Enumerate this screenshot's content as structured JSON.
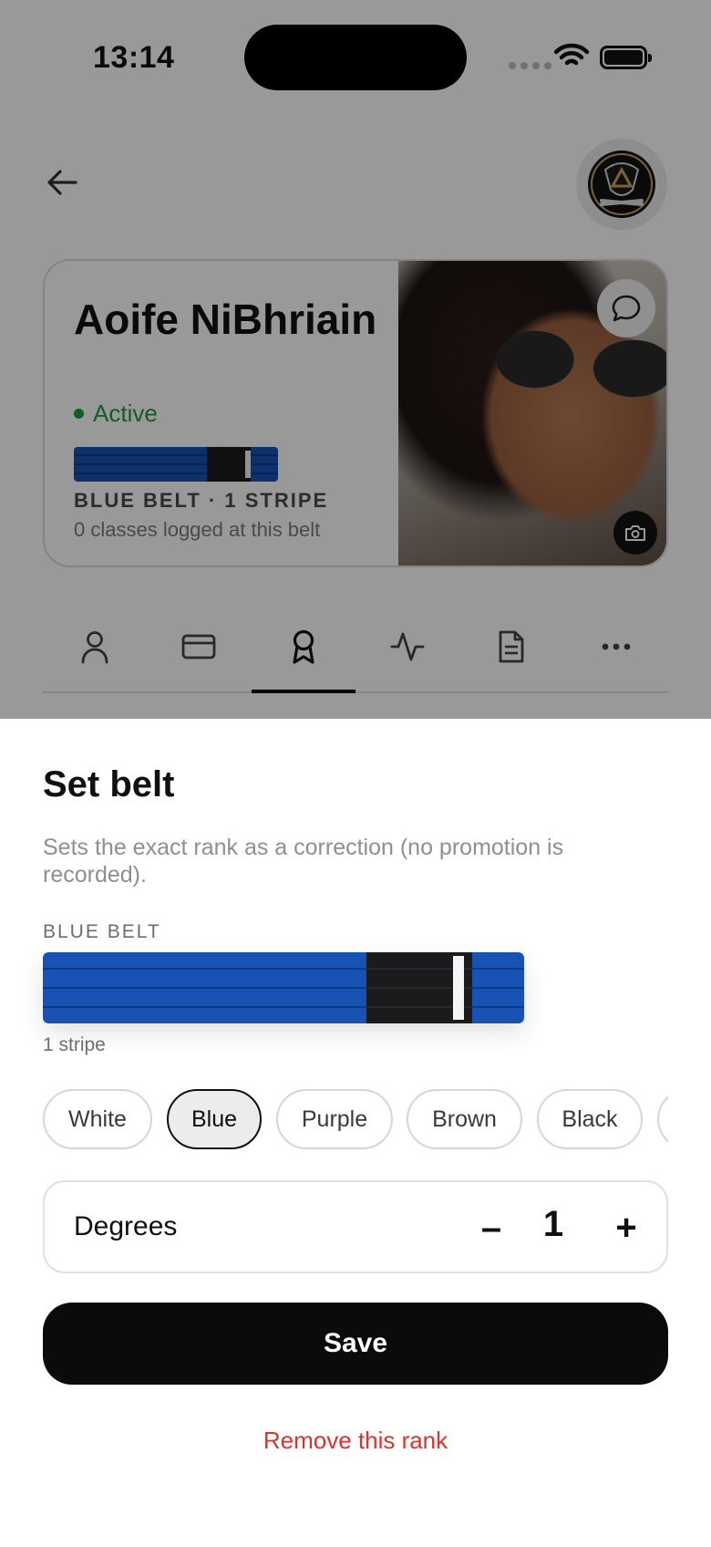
{
  "status_bar": {
    "time": "13:14"
  },
  "profile": {
    "name": "Aoife NiBhriain",
    "status": "Active",
    "rank": "BLUE BELT · 1 STRIPE",
    "classes": "0 classes logged at this belt"
  },
  "tabs": [
    "person-icon",
    "card-icon",
    "award-icon",
    "activity-icon",
    "document-icon",
    "more-icon"
  ],
  "sheet": {
    "title": "Set belt",
    "description": "Sets the exact rank as a correction (no promotion is recorded).",
    "belt_label": "BLUE BELT",
    "stripe_count": "1 stripe",
    "belt_options": [
      "White",
      "Blue",
      "Purple",
      "Brown",
      "Black"
    ],
    "selected_belt": "Blue",
    "degrees": {
      "label": "Degrees",
      "value": "1",
      "minus": "–",
      "plus": "+"
    },
    "save_label": "Save",
    "remove_label": "Remove this rank"
  },
  "colors": {
    "belt_blue": "#1752b4",
    "active_green": "#1f9b3f",
    "danger": "#e03030"
  }
}
